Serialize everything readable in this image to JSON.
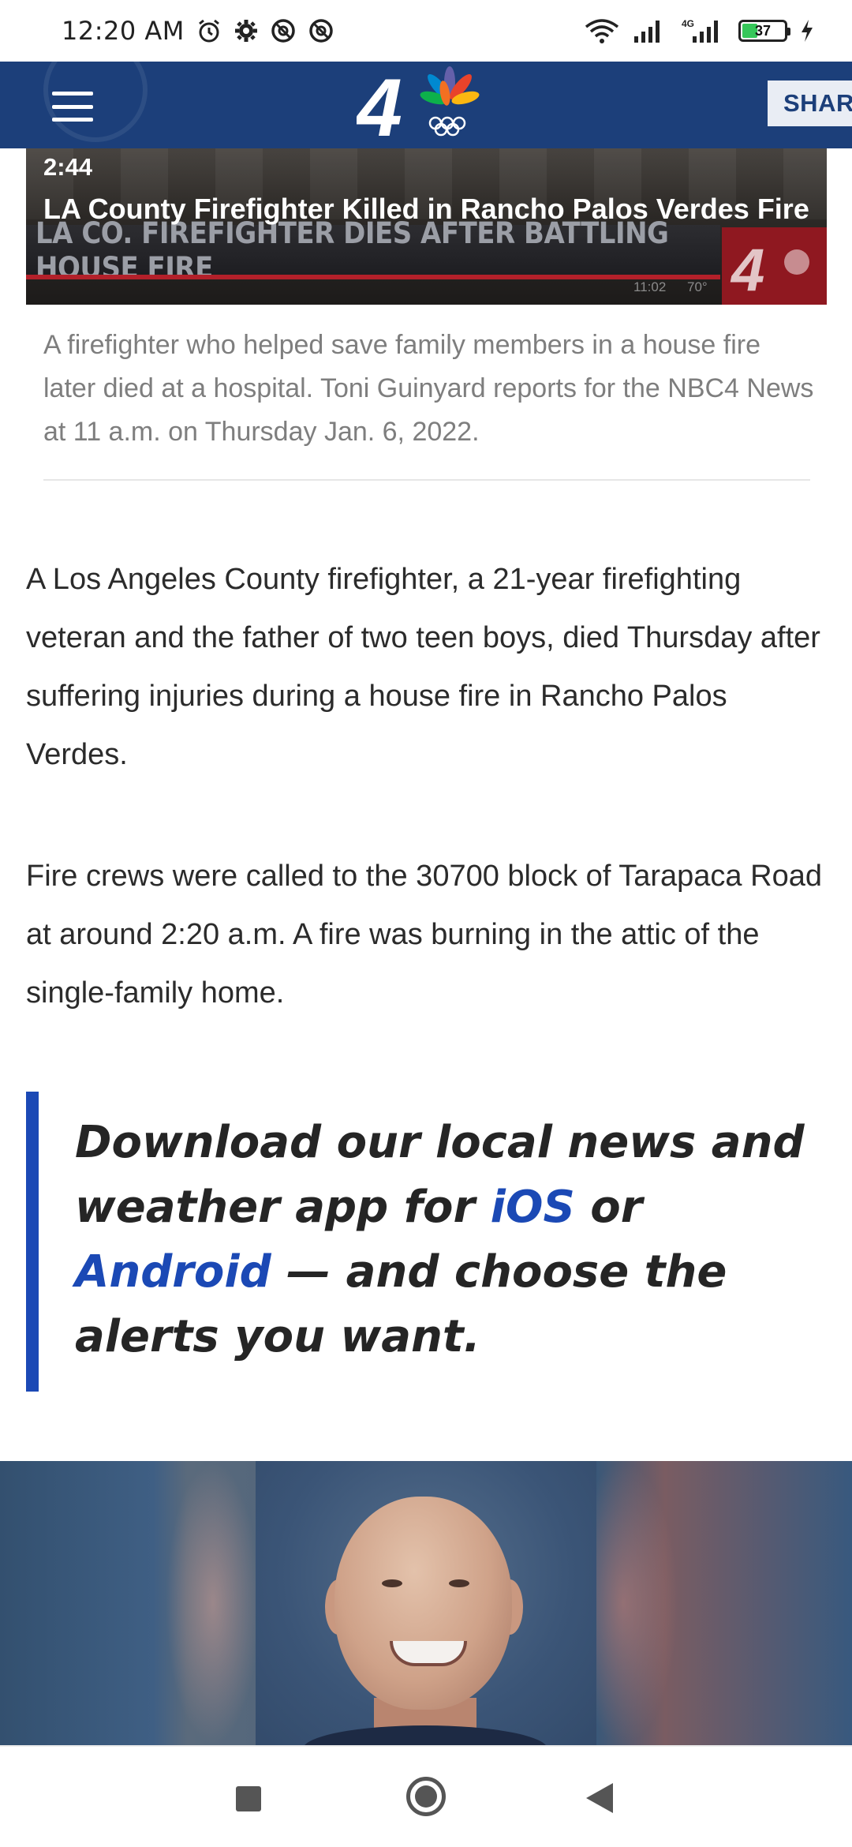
{
  "status_bar": {
    "time": "12:20 AM",
    "icons": [
      "alarm-icon",
      "gear-icon",
      "no-disturb-icon",
      "no-disturb-icon",
      "wifi-icon",
      "signal-icon",
      "signal-4g-icon",
      "battery-icon",
      "charging-icon"
    ],
    "network_label": "4G",
    "battery_level": "37"
  },
  "header": {
    "share_label": "SHAR",
    "logo_text": "4",
    "accent_color": "#1c3f7a"
  },
  "video": {
    "duration": "2:44",
    "title": "LA County Firefighter Killed in Rancho Palos Verdes Fire",
    "lower_third_text": "LA CO. FIREFIGHTER DIES AFTER BATTLING HOUSE FIRE",
    "lower_third_time": "11:02",
    "lower_third_temp": "70°",
    "caption": "A firefighter who helped save family members in a house fire later died at a hospital. Toni Guinyard reports for the NBC4 News at 11 a.m. on Thursday Jan. 6, 2022."
  },
  "article": {
    "paragraphs": [
      "A Los Angeles County firefighter, a 21-year firefighting veteran and the father of two teen boys, died Thursday after suffering injuries during a house fire in Rancho Palos Verdes.",
      "Fire crews were called to the 30700 block of Tarapaca Road at around 2:20 a.m. A fire was burning in the attic of the single-family home."
    ]
  },
  "promo": {
    "text_before": "Download our local news and weather app for ",
    "ios_label": "iOS",
    "or_label": " or ",
    "android_label": "Android",
    "text_after": " — and choose the alerts you want.",
    "accent_color": "#1b49b5"
  },
  "nav": {
    "icons": [
      "recents-icon",
      "home-icon",
      "back-icon"
    ]
  }
}
